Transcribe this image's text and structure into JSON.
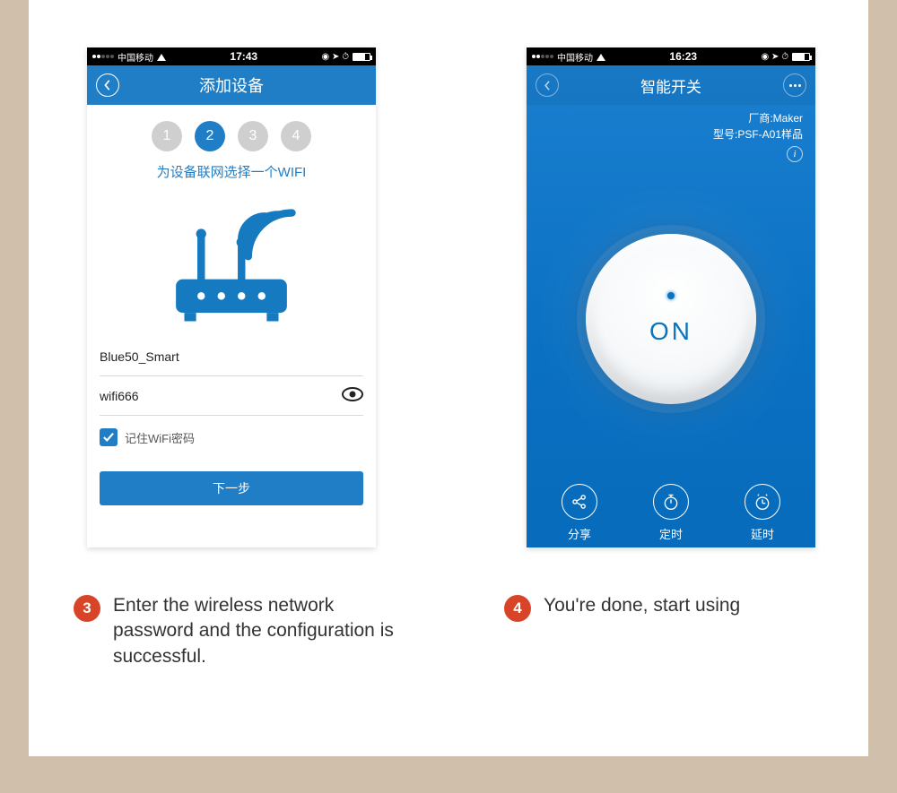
{
  "left_phone": {
    "status": {
      "carrier": "中国移动",
      "time": "17:43"
    },
    "nav_title": "添加设备",
    "steps": {
      "count": 4,
      "active": 2
    },
    "subtitle": "为设备联网选择一个WIFI",
    "ssid_value": "Blue50_Smart",
    "password_value": "wifi666",
    "remember_label": "记住WiFi密码",
    "remember_checked": true,
    "button_label": "下一步"
  },
  "right_phone": {
    "status": {
      "carrier": "中国移动",
      "time": "16:23"
    },
    "nav_title": "智能开关",
    "vendor_label": "厂商:",
    "vendor_value": "Maker",
    "model_label": "型号:",
    "model_value": "PSF-A01样品",
    "power_state": "ON",
    "actions": {
      "share": "分享",
      "timer": "定时",
      "delay": "延时"
    }
  },
  "captions": {
    "step3_num": "3",
    "step3_text": "Enter the wireless network password and the configuration is successful.",
    "step4_num": "4",
    "step4_text": "You're done, start using"
  }
}
